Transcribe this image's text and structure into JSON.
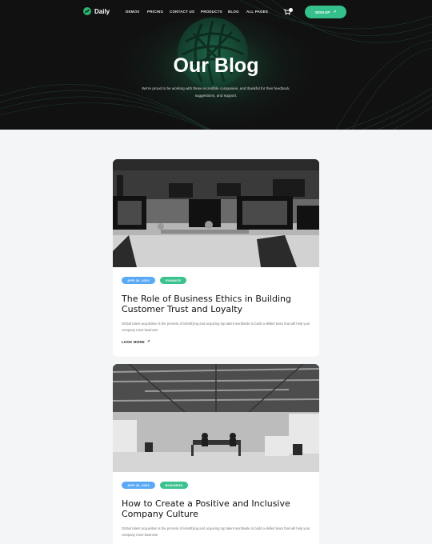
{
  "nav": {
    "logo": "Daily",
    "items": [
      "DEMOS",
      "PRICING",
      "CONTACT US",
      "PRODUCTS",
      "BLOG",
      "ALL PAGES"
    ],
    "cart_icon": "cart-icon",
    "signup_label": "SIGN UP"
  },
  "hero": {
    "title": "Our Blog",
    "subtitle": "We're proud to be working with these incredible companies, and thankful for their feedback, suggestions, and support."
  },
  "posts": [
    {
      "date": "APR 26, 2023",
      "category": "FINANCE",
      "title": "The Role of Business Ethics in Building Customer Trust and Loyalty",
      "excerpt": "Global talent acquisition is the process of identifying and acquiring top talent worldwide to build a skilled team that will help your company meet business",
      "link": "LOOK MORE"
    },
    {
      "date": "APR 26, 2023",
      "category": "BUSINESS",
      "title": "How to Create a Positive and Inclusive Company Culture",
      "excerpt": "Global talent acquisition is the process of identifying and acquiring top talent worldwide to build a skilled team that will help your company meet business",
      "link": ""
    }
  ],
  "colors": {
    "accent": "#35c08b",
    "date_badge": "#5aa9f5",
    "hero_bg": "#111111"
  }
}
